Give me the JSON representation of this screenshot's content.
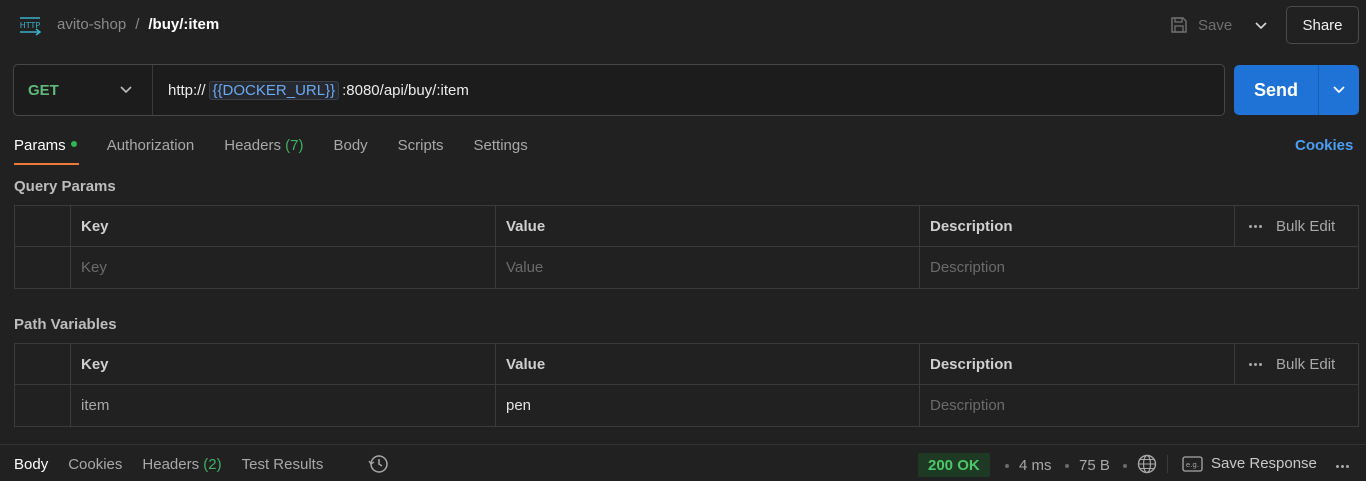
{
  "header": {
    "collection": "avito-shop",
    "separator": "/",
    "request_name": "/buy/:item",
    "save_label": "Save",
    "share_label": "Share"
  },
  "request": {
    "method": "GET",
    "url_prefix": "http://",
    "url_variable": "{{DOCKER_URL}}",
    "url_suffix": ":8080/api/buy/:item",
    "send_label": "Send"
  },
  "tabs": {
    "params": "Params",
    "authorization": "Authorization",
    "headers": "Headers",
    "headers_count": "(7)",
    "body": "Body",
    "scripts": "Scripts",
    "settings": "Settings",
    "cookies": "Cookies"
  },
  "query_params": {
    "title": "Query Params",
    "headers": {
      "key": "Key",
      "value": "Value",
      "description": "Description",
      "bulk_edit": "Bulk Edit"
    },
    "placeholder_row": {
      "key": "Key",
      "value": "Value",
      "description": "Description"
    }
  },
  "path_variables": {
    "title": "Path Variables",
    "headers": {
      "key": "Key",
      "value": "Value",
      "description": "Description",
      "bulk_edit": "Bulk Edit"
    },
    "rows": [
      {
        "key": "item",
        "value": "pen",
        "description_placeholder": "Description"
      }
    ]
  },
  "response_bar": {
    "body": "Body",
    "cookies": "Cookies",
    "headers": "Headers",
    "headers_count": "(2)",
    "test_results": "Test Results",
    "status": "200 OK",
    "time": "4 ms",
    "size": "75 B",
    "save_response": "Save Response"
  },
  "colors": {
    "background": "#212121",
    "accent_blue": "#1f73d6",
    "method_green": "#5fb87c",
    "status_green": "#4ec66a",
    "tab_underline": "#ec7a3a"
  }
}
